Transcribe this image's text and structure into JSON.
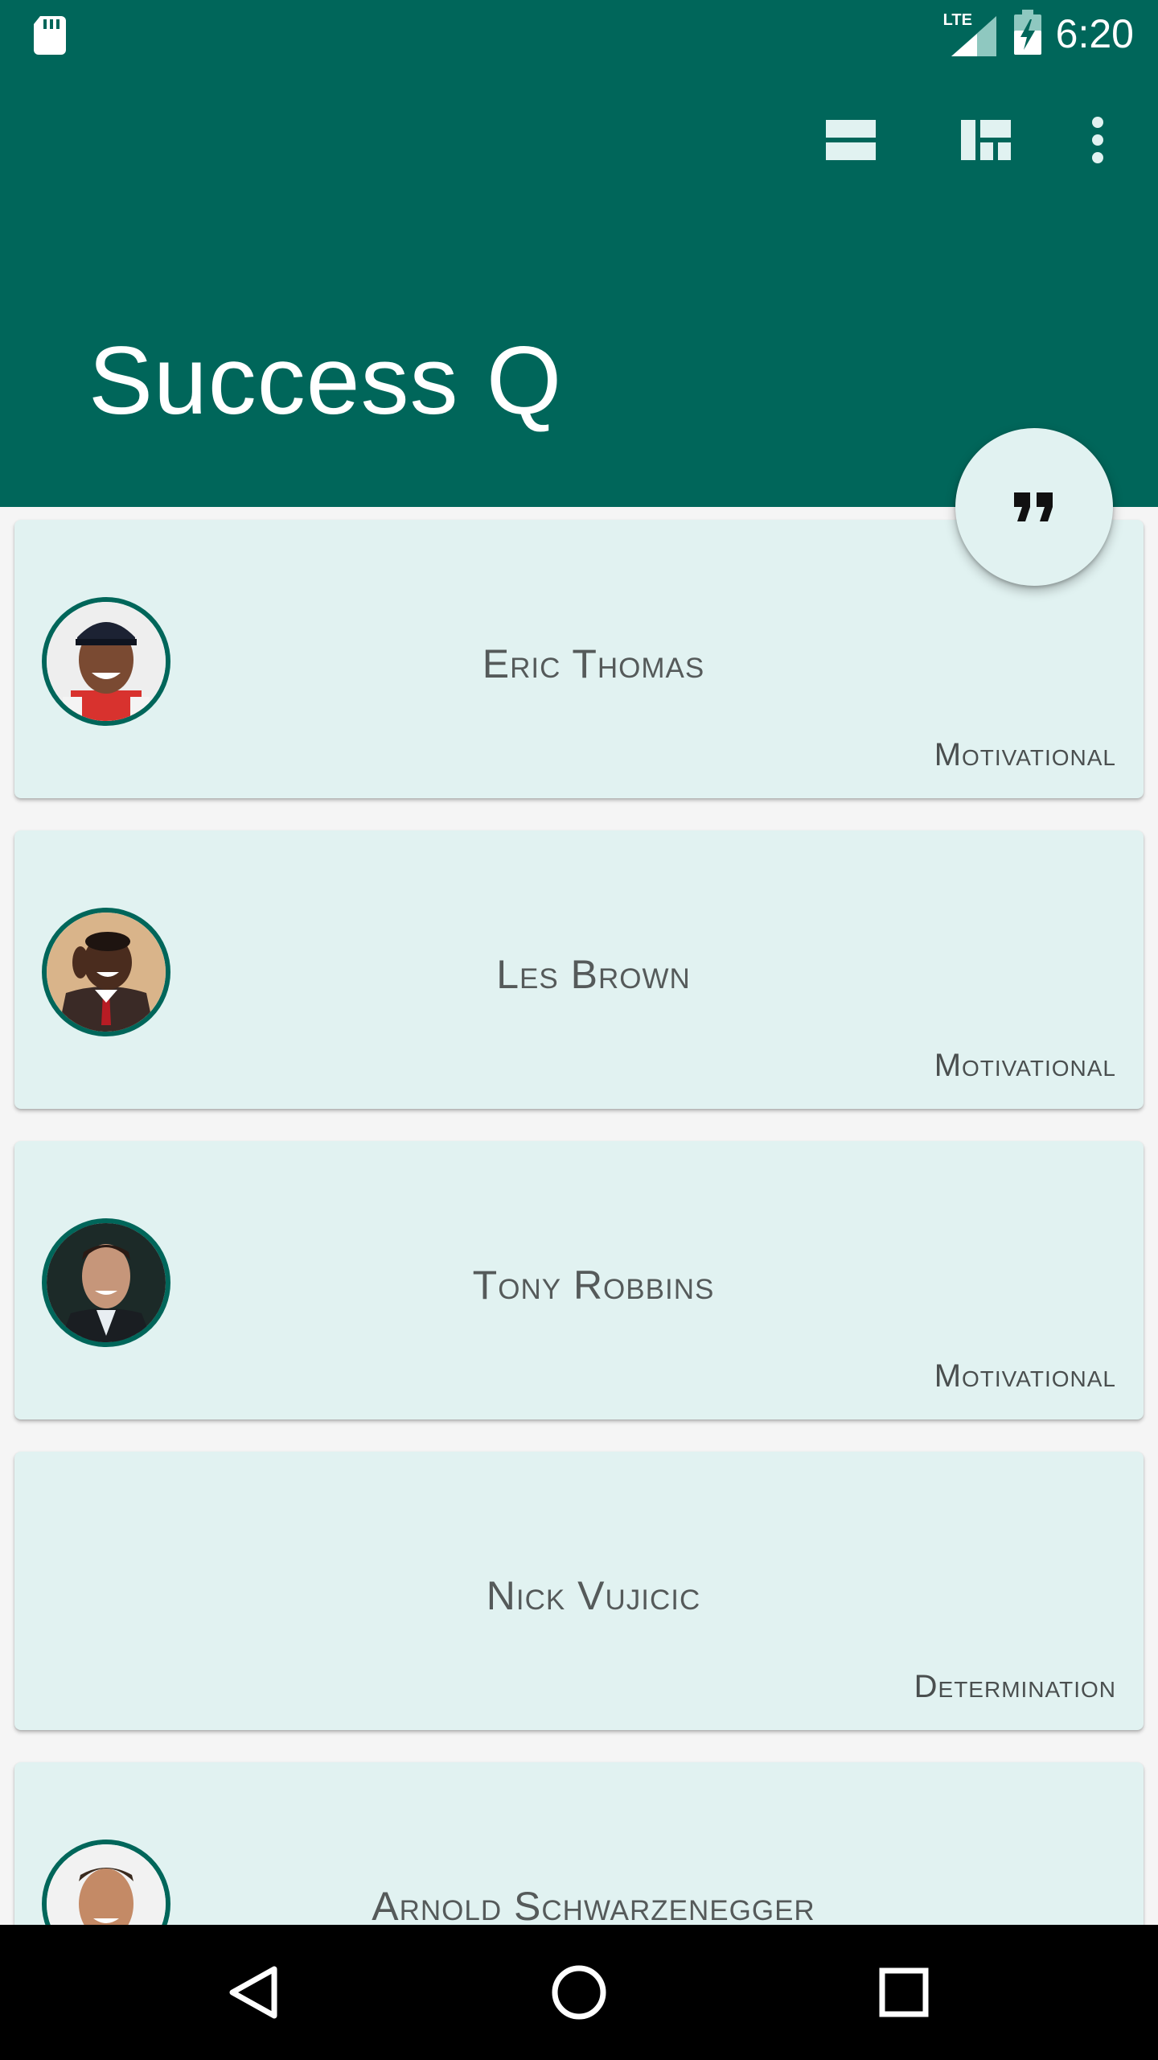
{
  "status_bar": {
    "time": "6:20",
    "network_label": "LTE",
    "icons": [
      "sd-card-icon",
      "lte-signal-icon",
      "battery-charging-icon"
    ]
  },
  "app_bar": {
    "title": "Success Q",
    "actions": [
      "list-view-icon",
      "grid-view-icon",
      "more-options-icon"
    ]
  },
  "fab": {
    "icon": "quote-icon"
  },
  "cards": [
    {
      "name": "Eric Thomas",
      "category": "Motivational",
      "has_avatar": true
    },
    {
      "name": "Les Brown",
      "category": "Motivational",
      "has_avatar": true
    },
    {
      "name": "Tony Robbins",
      "category": "Motivational",
      "has_avatar": true
    },
    {
      "name": "Nick Vujicic",
      "category": "Determination",
      "has_avatar": false
    },
    {
      "name": "Arnold Schwarzenegger",
      "category": "",
      "has_avatar": true
    }
  ],
  "nav_bar": {
    "icons": [
      "back-icon",
      "home-icon",
      "recents-icon"
    ]
  },
  "colors": {
    "primary": "#00665a",
    "card_background": "#e1f2f1",
    "text": "#555a5a"
  }
}
